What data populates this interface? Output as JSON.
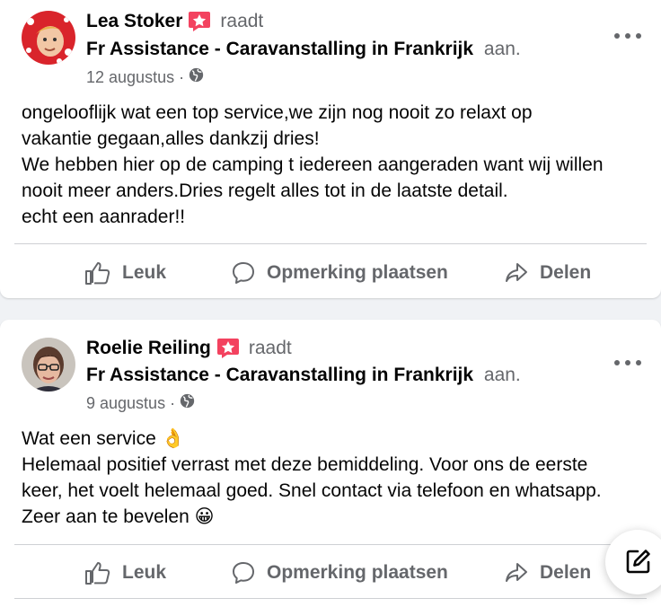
{
  "posts": [
    {
      "author": "Lea Stoker",
      "verb": "raadt",
      "page": "Fr Assistance - Caravanstalling in Frankrijk",
      "page_suffix": "aan.",
      "date": "12 augustus",
      "separator": "·",
      "text": "ongelooflijk wat een top service,we zijn nog nooit zo relaxt op\nvakantie gegaan,alles dankzij dries!\nWe hebben hier op de camping t iedereen aangeraden want wij willen\nnooit meer anders.Dries regelt alles tot in de laatste detail.\necht een aanrader!!",
      "actions": {
        "like": "Leuk",
        "comment": "Opmerking plaatsen",
        "share": "Delen"
      }
    },
    {
      "author": "Roelie Reiling",
      "verb": "raadt",
      "page": "Fr Assistance - Caravanstalling in Frankrijk",
      "page_suffix": "aan.",
      "date": "9 augustus",
      "separator": "·",
      "text": "Wat een service 👌\nHelemaal positief verrast met deze bemiddeling. Voor ons de eerste\nkeer, het voelt helemaal goed. Snel contact via telefoon en whatsapp.\nZeer aan te bevelen 😀",
      "actions": {
        "like": "Leuk",
        "comment": "Opmerking plaatsen",
        "share": "Delen"
      }
    }
  ],
  "colors": {
    "text": "#050505",
    "secondary": "#65676b",
    "badge": "#f3425f",
    "background": "#f0f2f5",
    "card": "#ffffff"
  },
  "icons": [
    "recommend-badge-icon",
    "globe-icon",
    "more-options-icon",
    "like-icon",
    "comment-icon",
    "share-icon",
    "compose-icon"
  ]
}
